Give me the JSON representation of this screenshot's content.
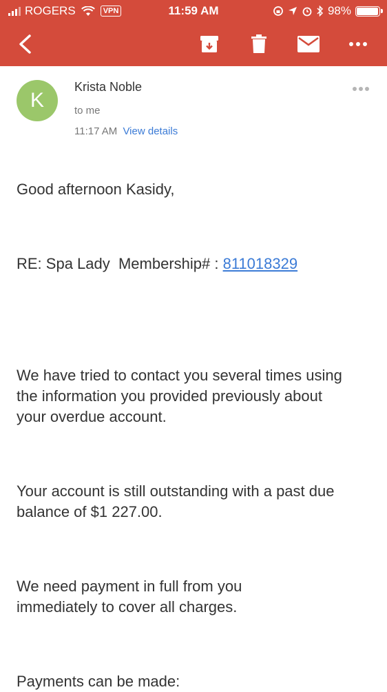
{
  "status_bar": {
    "carrier": "ROGERS",
    "vpn": "VPN",
    "time": "11:59 AM",
    "battery": "98%",
    "battery_level": 0.98
  },
  "colors": {
    "toolbar": "#d44b3b",
    "avatar": "#9bc76a",
    "link": "#3b7bd6"
  },
  "toolbar": {
    "icons": [
      "back-arrow-icon",
      "archive-icon",
      "trash-icon",
      "mail-icon",
      "more-icon"
    ]
  },
  "email": {
    "avatar_letter": "K",
    "sender": "Krista Noble",
    "recipient": "to me",
    "time": "11:17 AM",
    "view_details": "View details",
    "greeting": "Good afternoon Kasidy,",
    "re_prefix": "RE: Spa Lady  Membership# : ",
    "membership_number": "811018329",
    "para1": "We have tried to contact you several times using the information you provided previously about your overdue account.",
    "para2": "Your account is still outstanding with a past due balance of $1 227.00.",
    "para3": "We need payment in full from you immediately to cover all charges.",
    "para4": "Payments can be made:"
  }
}
